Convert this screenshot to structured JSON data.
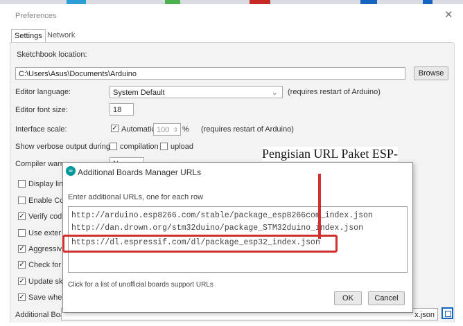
{
  "window": {
    "title": "Preferences",
    "close_glyph": "✕"
  },
  "tabs": [
    {
      "label": "Settings"
    },
    {
      "label": "Network"
    }
  ],
  "settings": {
    "sketchbook_label": "Sketchbook location:",
    "sketchbook_path": "C:\\Users\\Asus\\Documents\\Arduino",
    "browse_label": "Browse",
    "editor_language_label": "Editor language:",
    "editor_language_value": "System Default",
    "editor_language_note": "(requires restart of Arduino)",
    "font_size_label": "Editor font size:",
    "font_size_value": "18",
    "interface_scale_label": "Interface scale:",
    "automatic_label": "Automatic",
    "scale_value": "100",
    "scale_unit": "%",
    "scale_note": "(requires restart of Arduino)",
    "verbose_label": "Show verbose output during:",
    "compilation_label": "compilation",
    "upload_label": "upload",
    "compiler_warnings_label": "Compiler warn",
    "compiler_warnings_value": "None",
    "checkbox_rows": [
      {
        "label": "Display lin",
        "checked": false
      },
      {
        "label": "Enable Co",
        "checked": false
      },
      {
        "label": "Verify cod",
        "checked": true
      },
      {
        "label": "Use exter",
        "checked": false
      },
      {
        "label": "Aggressiv",
        "checked": true
      },
      {
        "label": "Check for",
        "checked": true
      },
      {
        "label": "Update sk",
        "checked": true
      },
      {
        "label": "Save whe",
        "checked": true
      }
    ],
    "additional_boards_label": "Additional Boa",
    "additional_boards_tail": "x.json"
  },
  "dialog": {
    "icon_text": "∞",
    "title": "Additional Boards Manager URLs",
    "instruction": "Enter additional URLs, one for each row",
    "urls": [
      "http://arduino.esp8266.com/stable/package_esp8266com_index.json",
      "http://dan.drown.org/stm32duino/package_STM32duino_index.json",
      "https://dl.espressif.com/dl/package_esp32_index.json"
    ],
    "link_text": "Click for a list of unofficial boards support URLs",
    "ok_label": "OK",
    "cancel_label": "Cancel"
  },
  "annotation": {
    "callout_text": "Pengisian URL Paket ESP-",
    "color": "#d32f2f"
  }
}
